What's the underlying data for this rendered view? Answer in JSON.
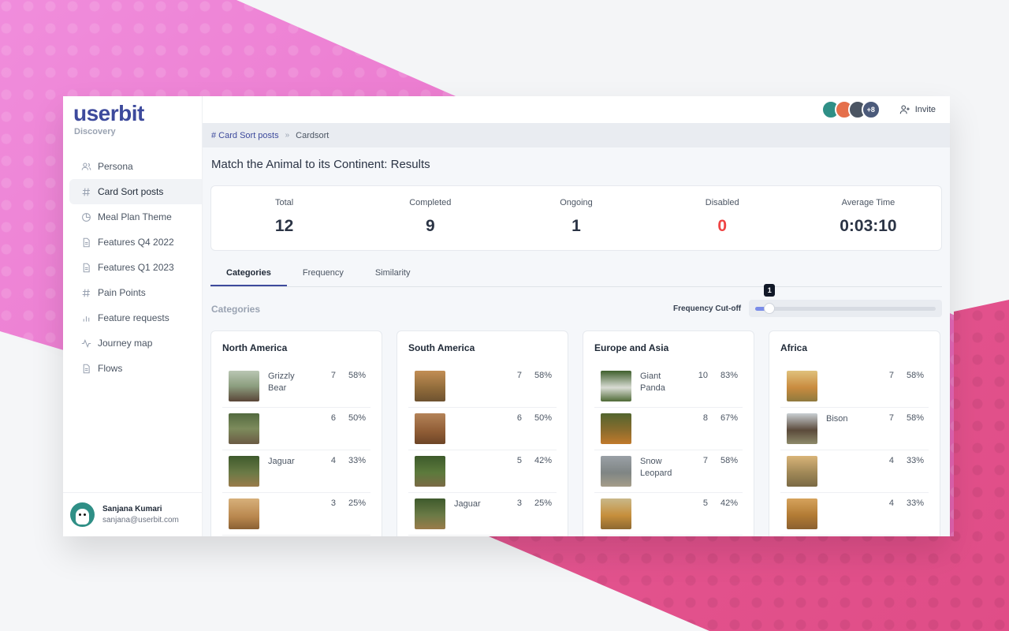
{
  "app": {
    "logo": "userbit",
    "logo_sub": "Discovery"
  },
  "sidebar": {
    "items": [
      {
        "label": "Persona",
        "icon": "users-icon"
      },
      {
        "label": "Card Sort posts",
        "icon": "hash-icon",
        "active": true
      },
      {
        "label": "Meal Plan Theme",
        "icon": "pie-icon"
      },
      {
        "label": "Features Q4 2022",
        "icon": "document-icon"
      },
      {
        "label": "Features Q1 2023",
        "icon": "document-icon"
      },
      {
        "label": "Pain Points",
        "icon": "hash-icon"
      },
      {
        "label": "Feature requests",
        "icon": "bar-chart-icon"
      },
      {
        "label": "Journey map",
        "icon": "activity-icon"
      },
      {
        "label": "Flows",
        "icon": "document-icon"
      }
    ],
    "user": {
      "name": "Sanjana Kumari",
      "email": "sanjana@userbit.com"
    }
  },
  "topbar": {
    "avatar_more": "+8",
    "invite_label": "Invite"
  },
  "breadcrumb": {
    "parent": "# Card Sort posts",
    "separator": "»",
    "current": "Cardsort"
  },
  "page": {
    "title": "Match the Animal to its Continent: Results"
  },
  "stats": [
    {
      "label": "Total",
      "value": "12"
    },
    {
      "label": "Completed",
      "value": "9"
    },
    {
      "label": "Ongoing",
      "value": "1"
    },
    {
      "label": "Disabled",
      "value": "0"
    },
    {
      "label": "Average Time",
      "value": "0:03:10"
    }
  ],
  "tabs": [
    {
      "label": "Categories",
      "active": true
    },
    {
      "label": "Frequency"
    },
    {
      "label": "Similarity"
    }
  ],
  "categories_section": {
    "label": "Categories",
    "cutoff_label": "Frequency Cut-off",
    "cutoff_value": "1",
    "cutoff_fraction": 0.08
  },
  "colors": {
    "brand": "#3d4a9c",
    "disabled_value": "#ef4444",
    "slider_fill": "#7b8de8"
  },
  "cards": [
    {
      "title": "North America",
      "rows": [
        {
          "name": "Grizzly Bear",
          "count": "7",
          "pct": "58%",
          "img": "t-bear"
        },
        {
          "name": "",
          "count": "6",
          "pct": "50%",
          "img": "t-armadillo"
        },
        {
          "name": "Jaguar",
          "count": "4",
          "pct": "33%",
          "img": "t-jaguar"
        },
        {
          "name": "",
          "count": "3",
          "pct": "25%",
          "img": "t-deer"
        }
      ]
    },
    {
      "title": "South America",
      "rows": [
        {
          "name": "",
          "count": "7",
          "pct": "58%",
          "img": "t-savanna"
        },
        {
          "name": "",
          "count": "6",
          "pct": "50%",
          "img": "t-kangaroo"
        },
        {
          "name": "",
          "count": "5",
          "pct": "42%",
          "img": "t-sloth"
        },
        {
          "name": "Jaguar",
          "count": "3",
          "pct": "25%",
          "img": "t-jaguar"
        }
      ]
    },
    {
      "title": "Europe and Asia",
      "rows": [
        {
          "name": "Giant Panda",
          "count": "10",
          "pct": "83%",
          "img": "t-panda"
        },
        {
          "name": "",
          "count": "8",
          "pct": "67%",
          "img": "t-tiger"
        },
        {
          "name": "Snow Leopard",
          "count": "7",
          "pct": "58%",
          "img": "t-leopard"
        },
        {
          "name": "",
          "count": "5",
          "pct": "42%",
          "img": "t-lion"
        }
      ]
    },
    {
      "title": "Africa",
      "rows": [
        {
          "name": "",
          "count": "7",
          "pct": "58%",
          "img": "t-giraffe"
        },
        {
          "name": "Bison",
          "count": "7",
          "pct": "58%",
          "img": "t-bison"
        },
        {
          "name": "",
          "count": "4",
          "pct": "33%",
          "img": "t-zebra"
        },
        {
          "name": "",
          "count": "4",
          "pct": "33%",
          "img": "t-lion2"
        }
      ]
    }
  ]
}
